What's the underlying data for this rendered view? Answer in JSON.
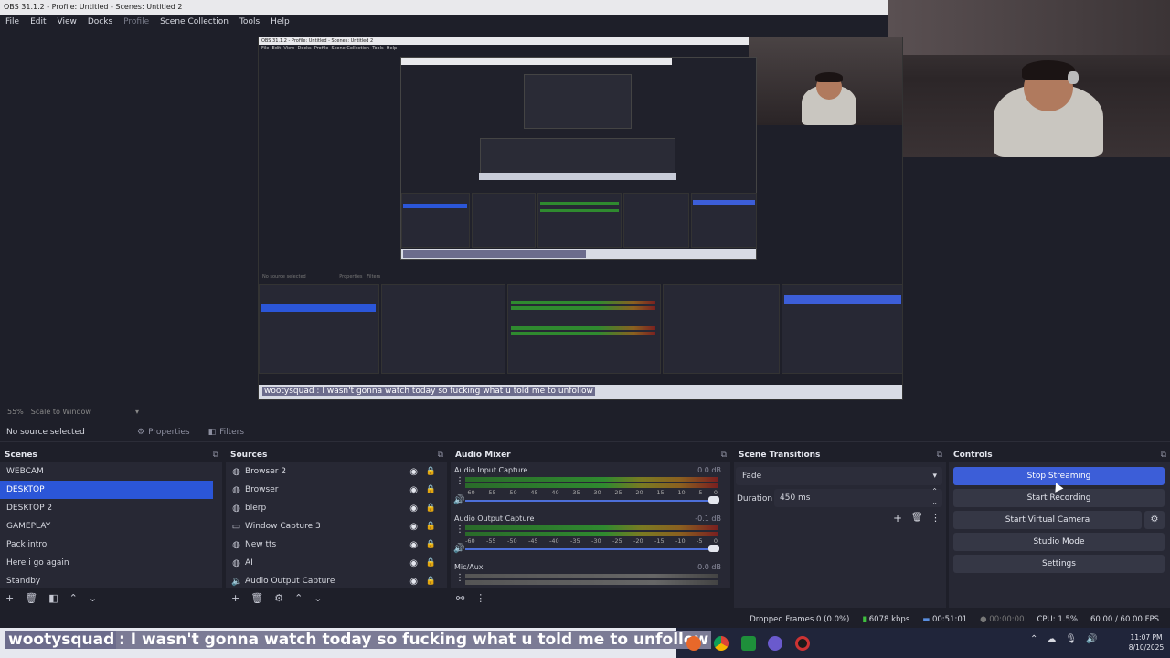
{
  "window": {
    "title": "OBS 31.1.2 - Profile: Untitled - Scenes: Untitled 2"
  },
  "menu": [
    "File",
    "Edit",
    "View",
    "Docks",
    "Profile",
    "Scene Collection",
    "Tools",
    "Help"
  ],
  "preview": {
    "nested_title": "OBS 31.1.2 - Profile: Untitled - Scenes: Untitled 2",
    "nested_chat": "wootysquad : I wasn't gonna watch today so fucking what u told me to unfollow"
  },
  "scalebar": {
    "zoom": "55%",
    "scale_mode": "Scale to Window"
  },
  "sourcebar": {
    "label": "No source selected",
    "properties": "Properties",
    "filters": "Filters"
  },
  "scenes": {
    "title": "Scenes",
    "items": [
      "WEBCAM",
      "DESKTOP",
      "DESKTOP 2",
      "GAMEPLAY",
      "Pack intro",
      "Here i go again",
      "Standby"
    ],
    "selected_index": 1
  },
  "sources": {
    "title": "Sources",
    "items": [
      {
        "name": "Browser 2",
        "icon": "globe-icon"
      },
      {
        "name": "Browser",
        "icon": "globe-icon"
      },
      {
        "name": "blerp",
        "icon": "globe-icon"
      },
      {
        "name": "Window Capture 3",
        "icon": "window-icon"
      },
      {
        "name": "New tts",
        "icon": "globe-icon"
      },
      {
        "name": "AI",
        "icon": "globe-icon"
      },
      {
        "name": "Audio Output Capture",
        "icon": "speaker-icon"
      }
    ]
  },
  "audio_mixer": {
    "title": "Audio Mixer",
    "ticks": [
      "-60",
      "-55",
      "-50",
      "-45",
      "-40",
      "-35",
      "-30",
      "-25",
      "-20",
      "-15",
      "-10",
      "-5",
      "0"
    ],
    "channels": [
      {
        "name": "Audio Input Capture",
        "db": "0.0 dB",
        "active": true
      },
      {
        "name": "Audio Output Capture",
        "db": "-0.1 dB",
        "active": true
      },
      {
        "name": "Mic/Aux",
        "db": "0.0 dB",
        "active": false
      }
    ]
  },
  "scene_transitions": {
    "title": "Scene Transitions",
    "transition": "Fade",
    "duration_label": "Duration",
    "duration_value": "450 ms"
  },
  "controls": {
    "title": "Controls",
    "stop_streaming": "Stop Streaming",
    "start_recording": "Start Recording",
    "start_virtual_camera": "Start Virtual Camera",
    "studio_mode": "Studio Mode",
    "settings": "Settings"
  },
  "status": {
    "dropped_frames": "Dropped Frames 0 (0.0%)",
    "bitrate": "6078 kbps",
    "stream_time": "00:51:01",
    "record_time": "00:00:00",
    "cpu": "CPU: 1.5%",
    "fps": "60.00 / 60.00 FPS"
  },
  "chat": {
    "user": "wootysquad",
    "message": ": I wasn't gonna watch today so fucking what u told me to unfollow"
  },
  "clock": {
    "time": "11:07 PM",
    "date": "8/10/2025"
  },
  "colors": {
    "accent": "#2b56d8",
    "panel": "#272834",
    "bg": "#1e1f29"
  }
}
